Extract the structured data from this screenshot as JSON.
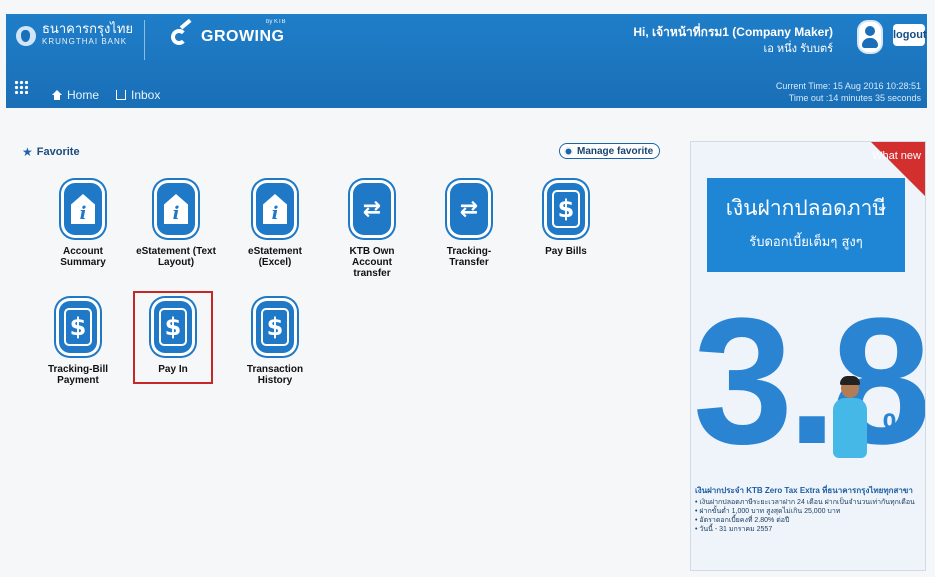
{
  "header": {
    "bank_name_th": "ธนาคารกรุงไทย",
    "bank_name_en": "KRUNGTHAI BANK",
    "product_name": "GROWING",
    "product_by": "by KTB",
    "greeting": "Hi, เจ้าหน้าที่กรม1 (Company Maker)",
    "user_name": "เอ หนึ่ง รับบตร์",
    "logout_label": "logout",
    "nav": {
      "home_label": "Home",
      "inbox_label": "Inbox"
    },
    "current_time": "Current Time: 15 Aug 2016 10:28:51",
    "timeout": "Time out :14 minutes 35 seconds"
  },
  "favorite": {
    "title": "Favorite",
    "manage_label": "Manage favorite",
    "tiles": [
      {
        "icon": "account-summary-icon",
        "label": "Account Summary"
      },
      {
        "icon": "estatement-text-icon",
        "label": "eStatement (Text Layout)"
      },
      {
        "icon": "estatement-excel-icon",
        "label": "eStatement (Excel)"
      },
      {
        "icon": "transfer-icon",
        "label": "KTB Own Account transfer"
      },
      {
        "icon": "tracking-transfer-icon",
        "label": "Tracking- Transfer"
      },
      {
        "icon": "dollar-icon",
        "label": "Pay Bills"
      },
      {
        "icon": "dollar-icon",
        "label": "Tracking-Bill Payment"
      },
      {
        "icon": "dollar-icon",
        "label": "Pay In"
      },
      {
        "icon": "dollar-icon",
        "label": "Transaction History"
      }
    ]
  },
  "promo": {
    "corner_label": "What new",
    "headline": "เงินฝากปลอดภาษี",
    "subheadline": "รับดอกเบี้ยเต็มๆ สูงๆ",
    "rate": "3.8",
    "percent": "%",
    "product_line": "เงินฝากประจำ KTB Zero Tax Extra ที่ธนาคารกรุงไทยทุกสาขา",
    "bullets": [
      "เงินฝากปลอดภาษีระยะเวลาฝาก 24 เดือน ฝากเป็นจำนวนเท่ากันทุกเดือน",
      "ฝากขั้นต่ำ 1,000 บาท สูงสุดไม่เกิน 25,000 บาท",
      "อัตราดอกเบี้ยคงที่ 2.80% ต่อปี",
      "วันนี้ - 31 มกราคม 2557"
    ]
  }
}
